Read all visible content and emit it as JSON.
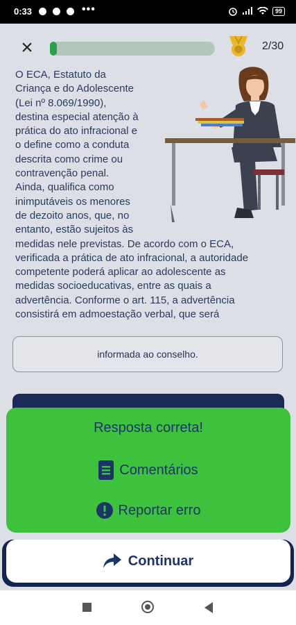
{
  "status_bar": {
    "time": "0:33",
    "more": "•••",
    "battery": "99"
  },
  "header": {
    "close_icon": "×",
    "progress_fraction": 0.04,
    "counter": "2/30"
  },
  "question": {
    "text": "O ECA, Estatuto da Criança e do Adolescente (Lei nº 8.069/1990), destina especial atenção à prática do ato infracional e o define como a conduta descrita como crime ou contravenção penal. Ainda, qualifica como inimputáveis os menores de dezoito anos, que, no entanto, estão sujeitos às medidas nele previstas. De acordo com o ECA, verificada a prática de ato infracional, a autoridade competente poderá aplicar ao adolescente as medidas socioeducativas, entre as quais a advertência. Conforme o art. 115, a advertência consistirá em admoestação verbal, que será"
  },
  "answer_option": {
    "text": "informada ao conselho."
  },
  "feedback": {
    "title": "Resposta correta!",
    "comments_label": "Comentários",
    "report_label": "Reportar erro"
  },
  "continue_label": "Continuar",
  "colors": {
    "success": "#3ec23e",
    "navy": "#1a3566",
    "progress": "#2aa14a"
  }
}
